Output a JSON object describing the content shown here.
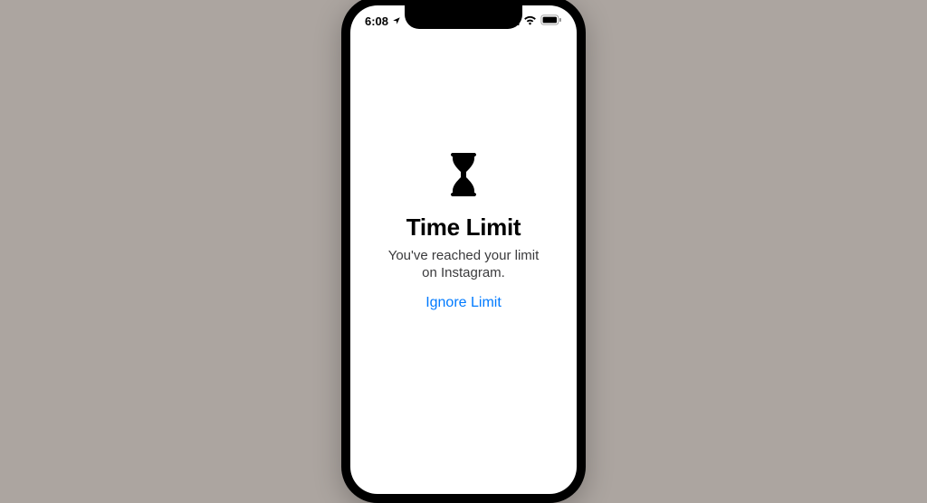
{
  "statusBar": {
    "time": "6:08",
    "locationOn": true
  },
  "screenTime": {
    "title": "Time Limit",
    "message_line1": "You've reached your limit",
    "message_line2": "on Instagram.",
    "ignore_label": "Ignore Limit"
  },
  "colors": {
    "link": "#007aff",
    "text": "#000",
    "secondaryText": "#3a3a3c"
  }
}
